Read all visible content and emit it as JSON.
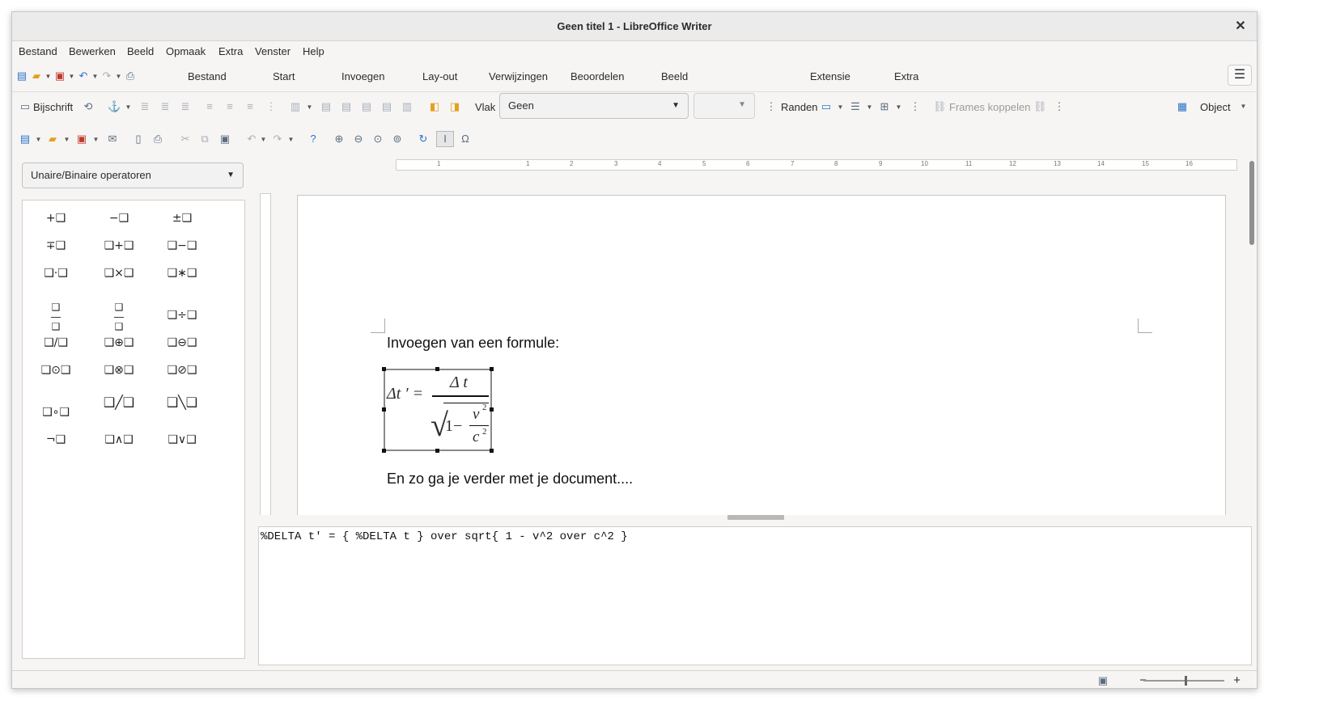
{
  "window": {
    "title": "Geen titel 1 - LibreOffice Writer",
    "close_glyph": "✕"
  },
  "menubar": [
    "Bestand",
    "Bewerken",
    "Beeld",
    "Opmaak",
    "Extra",
    "Venster",
    "Help"
  ],
  "tabs": [
    "Bestand",
    "Start",
    "Invoegen",
    "Lay-out",
    "Verwijzingen",
    "Beoordelen",
    "Beeld",
    "Extensie",
    "Extra"
  ],
  "toolbar1": {
    "caption_label": "Bijschrift",
    "area_label": "Vlak",
    "area_value": "Geen",
    "borders_label": "Randen",
    "link_frames_label": "Frames koppelen",
    "object_label": "Object"
  },
  "sidebar": {
    "category": "Unaire/Binaire operatoren",
    "symbols": [
      [
        "+❑",
        "−❑",
        "±❑"
      ],
      [
        "∓❑",
        "❑+❑",
        "❑−❑"
      ],
      [
        "❑·❑",
        "❑×❑",
        "❑∗❑"
      ],
      [
        "❑⁄❑",
        "❑⁄❑",
        "❑÷❑"
      ],
      [
        "❑/❑",
        "❑⊕❑",
        "❑⊖❑"
      ],
      [
        "❑⊙❑",
        "❑⊗❑",
        "❑⊘❑"
      ],
      [
        "❑∘❑",
        "❑╱❑",
        "❑╲❑"
      ],
      [
        "¬❑",
        "❑∧❑",
        "❑∨❑"
      ]
    ]
  },
  "ruler": {
    "h_ticks": [
      "1",
      "1",
      "2",
      "3",
      "4",
      "5",
      "6",
      "7",
      "8",
      "9",
      "10",
      "11",
      "12",
      "13",
      "14",
      "15",
      "16"
    ]
  },
  "document": {
    "line1": "Invoegen van een formule:",
    "line2": "En zo ga je verder met je document....",
    "formula": {
      "lhs": "Δt ′ =",
      "num": "Δ t",
      "one": "1−",
      "v": "v",
      "c": "c",
      "sq": "2"
    }
  },
  "editor": {
    "content": "%DELTA t' = { %DELTA t } over sqrt{ 1 - v^2 over c^2 }"
  },
  "statusbar": {
    "zoom_minus": "−",
    "zoom_plus": "+"
  }
}
